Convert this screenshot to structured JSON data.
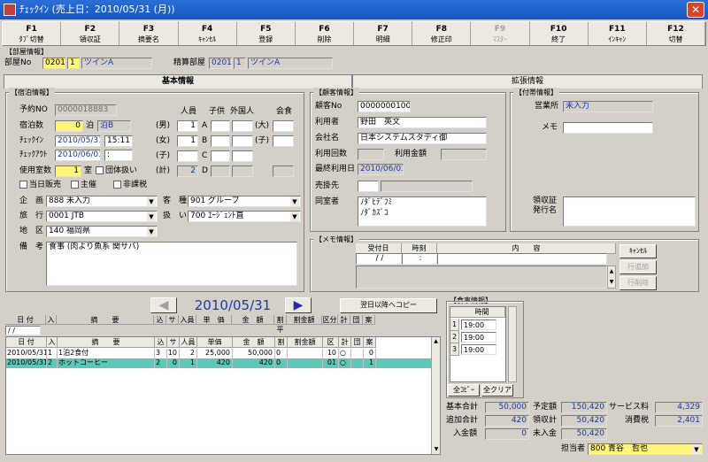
{
  "window": {
    "title": "ﾁｪｯｸｲﾝ (売上日：2010/05/31 (月))",
    "close": "✕"
  },
  "fkeys": [
    {
      "key": "F1",
      "label": "ﾀﾌﾞ切替"
    },
    {
      "key": "F2",
      "label": "領収証"
    },
    {
      "key": "F3",
      "label": "摘要名"
    },
    {
      "key": "F4",
      "label": "ｷｬﾝｾﾙ"
    },
    {
      "key": "F5",
      "label": "登録"
    },
    {
      "key": "F6",
      "label": "削除"
    },
    {
      "key": "F7",
      "label": "明細"
    },
    {
      "key": "F8",
      "label": "修正印"
    },
    {
      "key": "F9",
      "label": "ﾏｽﾀｰ"
    },
    {
      "key": "F10",
      "label": "終了"
    },
    {
      "key": "F11",
      "label": "ｲﾝｷｬﾝ"
    },
    {
      "key": "F12",
      "label": "切替"
    }
  ],
  "room": {
    "group": "【部屋情報】",
    "label": "部屋No",
    "no": "0201",
    "count": "1",
    "type": "ツインA",
    "settle_label": "精算部屋",
    "settle_no": "0201",
    "settle_count": "1",
    "settle_type": "ツインA"
  },
  "tabs": {
    "basic": "基本情報",
    "ext": "拡張情報"
  },
  "stay": {
    "group": "【宿泊情報】",
    "resno_label": "予約NO",
    "resno": "0000018883",
    "nights_label": "宿泊数",
    "nights": "0",
    "nights_unit": "泊",
    "meal": "泊B",
    "checkin_label": "ﾁｪｯｸｲﾝ",
    "checkin_date": "2010/05/31",
    "checkin_time": "15:11",
    "checkout_label": "ﾁｪｯｸｱｳﾄ",
    "checkout_date": "2010/06/03",
    "checkout_time": ":",
    "rooms_label": "使用室数",
    "rooms": "1",
    "rooms_unit": "室",
    "group_chk": "団体扱い",
    "col_adult": "人員",
    "col_child": "子供",
    "col_foreign": "外国人",
    "col_member": "会食",
    "male": "(男)",
    "male_val": "1",
    "male_code": "A",
    "female": "(女)",
    "female_val": "1",
    "female_code": "B",
    "child": "(子)",
    "child_code": "C",
    "total": "(計)",
    "total_val": "2",
    "total_code": "D",
    "big": "(大)",
    "small": "(子)",
    "day": "当日販売",
    "main": "主催",
    "tax": "非課税",
    "plan_label": "企　画",
    "plan": "888 未入力",
    "type_label": "客　種",
    "type": "901 グループ",
    "agent_label": "旅　行",
    "agent": "0001 JTB",
    "handle_label": "扱　い",
    "handle": "700 ｴｰｼﾞｪﾝﾄ直",
    "area_label": "地　区",
    "area": "140 福岡県",
    "note_label": "備　考",
    "note": "食事 (肉より魚系 関サバ)"
  },
  "customer": {
    "group": "【顧客情報】",
    "no_label": "顧客No",
    "no": "0000000100",
    "user_label": "利用者",
    "user": "野田　英文",
    "company_label": "会社名",
    "company": "日本システムスタディ御",
    "use_count_label": "利用回数",
    "use_amt_label": "利用金額",
    "last_label": "最終利用日",
    "last": "2010/06/03",
    "send_label": "売掛先",
    "with_label": "同室者",
    "with1": "ﾉﾀﾞﾋﾃﾞﾌﾐ",
    "with2": "ﾉﾀﾞｶｽﾞｺ"
  },
  "extra": {
    "group": "【付帯情報】",
    "office_label": "営業所",
    "office": "未入力",
    "memo_label": "メモ",
    "issuer_label": "領収証\n発行名"
  },
  "memo": {
    "group": "【メモ情報】",
    "col_date": "受付日",
    "col_time": "時刻",
    "col_content": "内　　容",
    "date": "/ /",
    "time": ":",
    "btn_cancel": "ｷｬﾝｾﾙ",
    "btn_add": "行追加",
    "btn_del": "行削除"
  },
  "nav": {
    "date": "2010/05/31",
    "copy": "翌日以降へコピー"
  },
  "detail": {
    "headers": [
      "日 付",
      "入",
      "摘　　要",
      "込",
      "サ",
      "人員",
      "単価",
      "金　額",
      "割",
      "割金額",
      "区",
      "計",
      "団",
      "案"
    ],
    "toplabels": [
      "日 付",
      "入",
      "摘　　要",
      "込",
      "サ",
      "入員",
      "単　価",
      "金　額",
      "割平",
      "割金額",
      "区分",
      "計",
      "団",
      "案"
    ],
    "rows": [
      {
        "date": "2010/05/31",
        "in": "1",
        "desc": "1泊2食付",
        "inc": "3",
        "sv": "10",
        "qty": "2",
        "price": "25,000",
        "amt": "50,000",
        "disc": "0",
        "discamt": "",
        "cls": "10",
        "calc": "○",
        "grp": "",
        "plan": "0"
      },
      {
        "date": "2010/05/31",
        "in": "2",
        "desc": "ホットコーヒー",
        "inc": "2",
        "sv": "0",
        "qty": "1",
        "price": "420",
        "amt": "420",
        "disc": "0",
        "discamt": "",
        "cls": "01",
        "calc": "○",
        "grp": "",
        "plan": "1"
      }
    ]
  },
  "meal": {
    "group": "【食事情報】",
    "col": "時間",
    "rows": [
      {
        "n": "1",
        "t": "19:00"
      },
      {
        "n": "2",
        "t": "19:00"
      },
      {
        "n": "3",
        "t": "19:00"
      }
    ],
    "btn_all": "全ｺﾋﾟｰ",
    "btn_clear": "全クリア"
  },
  "totals": {
    "base_label": "基本合計",
    "base": "50,000",
    "plan_label": "予定額",
    "plan": "150,420",
    "service_label": "サービス料",
    "service": "4,329",
    "add_label": "追加合計",
    "add": "420",
    "paid_label": "領収計",
    "paid": "50,420",
    "tax_label": "消費税",
    "tax": "2,401",
    "dep_label": "入金額",
    "dep": "0",
    "unpaid_label": "未入金",
    "unpaid": "50,420",
    "staff_label": "担当者",
    "staff": "800 青谷　哲也"
  },
  "colors": {
    "title": "#1756c2",
    "yellow": "#fff57a",
    "teal": "#5fc7b8"
  }
}
